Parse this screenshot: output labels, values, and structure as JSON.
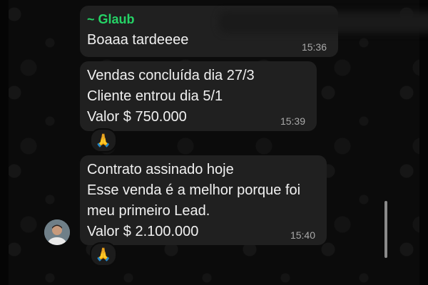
{
  "messages": [
    {
      "sender": "~ Glaub",
      "lines": [
        "Boaaa tardeeee"
      ],
      "time": "15:36"
    },
    {
      "lines": [
        "Vendas concluída dia 27/3",
        "Cliente entrou dia 5/1",
        "Valor $ 750.000"
      ],
      "time": "15:39",
      "reaction": "🙏"
    },
    {
      "lines": [
        "Contrato assinado hoje",
        "Esse venda é a melhor porque foi",
        "meu primeiro Lead.",
        "Valor $ 2.100.000"
      ],
      "time": "15:40",
      "reaction": "🙏"
    }
  ],
  "colors": {
    "background": "#0b0b0b",
    "bubble": "#202020",
    "sender_name": "#25d366",
    "timestamp": "#a9a9a9"
  },
  "icons": [
    "folded-hands-icon",
    "avatar"
  ]
}
